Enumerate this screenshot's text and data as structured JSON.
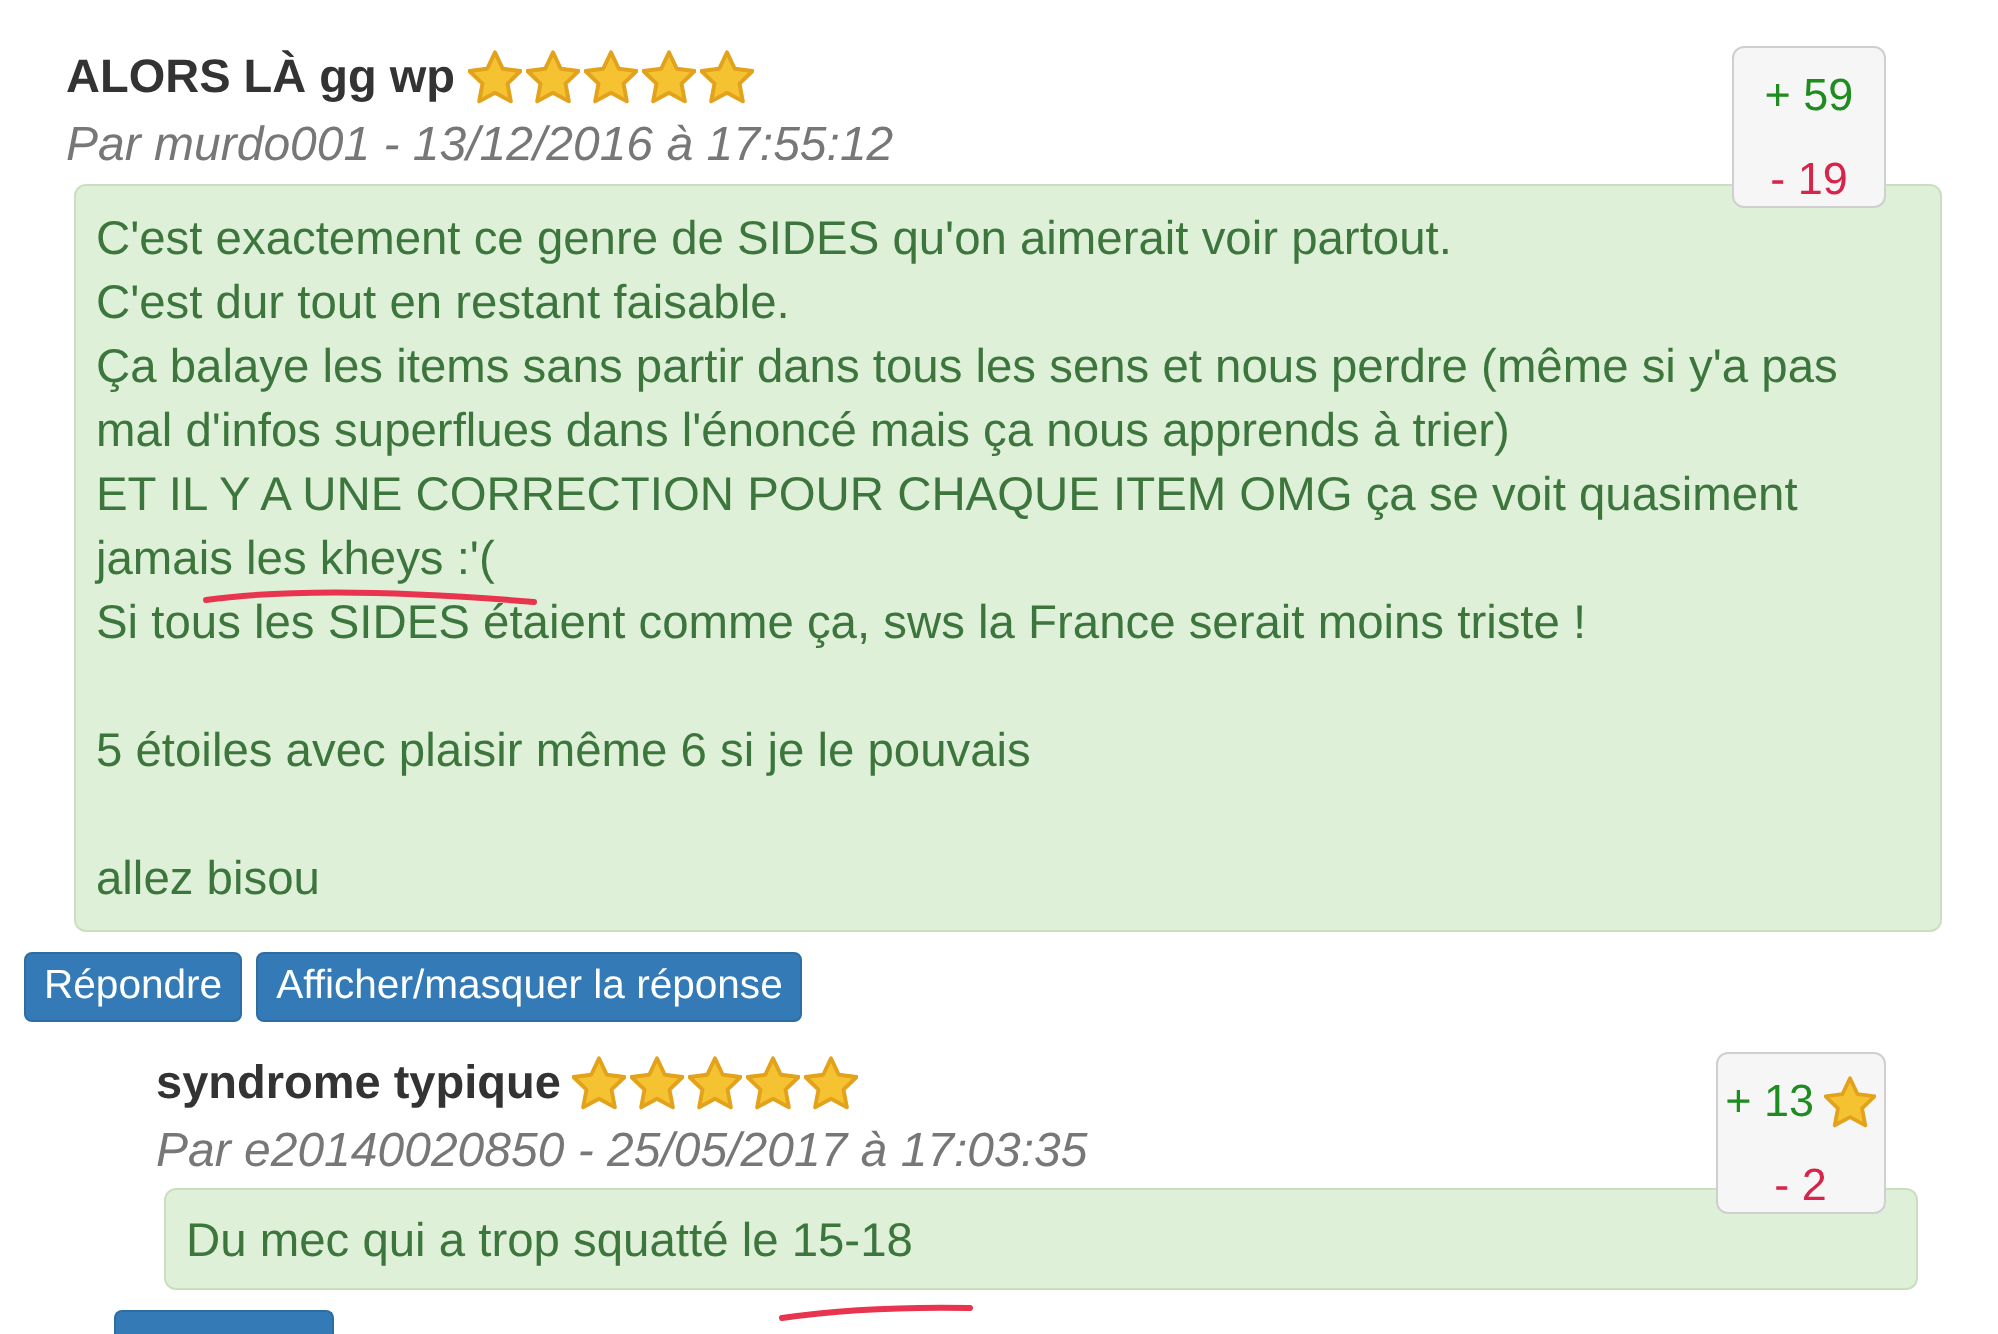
{
  "comments": [
    {
      "title": "ALORS LÀ gg wp",
      "stars": 5,
      "meta": "Par murdo001 - 13/12/2016 à 17:55:12",
      "votes": {
        "up": "+ 59",
        "down": "- 19",
        "starred": false
      },
      "body": [
        [
          "C'est exactement ce genre de SIDES qu'on aimerait voir partout.",
          "C'est dur tout en restant faisable.",
          "Ça balaye les items sans partir dans tous les sens et nous perdre (même si y'a pas mal d'infos superflues dans l'énoncé mais ça nous apprends à trier)",
          "ET IL Y A UNE CORRECTION POUR CHAQUE ITEM OMG ça se voit quasiment jamais les kheys :'(",
          "Si tous les SIDES étaient comme ça, sws la France serait moins triste !"
        ],
        [
          "5 étoiles avec plaisir même 6 si je le pouvais"
        ],
        [
          "allez bisou"
        ]
      ],
      "buttons": [
        "Répondre",
        "Afficher/masquer la réponse"
      ],
      "replies": [
        {
          "title": "syndrome typique",
          "stars": 5,
          "meta": "Par e20140020850 - 25/05/2017 à 17:03:35",
          "votes": {
            "up": "+ 13",
            "down": "- 2",
            "starred": true
          },
          "body": [
            [
              "Du mec qui a trop squatté le 15-18"
            ]
          ],
          "partial_button": true
        }
      ]
    }
  ],
  "annotations": [
    {
      "kind": "underline"
    },
    {
      "kind": "underline"
    }
  ]
}
